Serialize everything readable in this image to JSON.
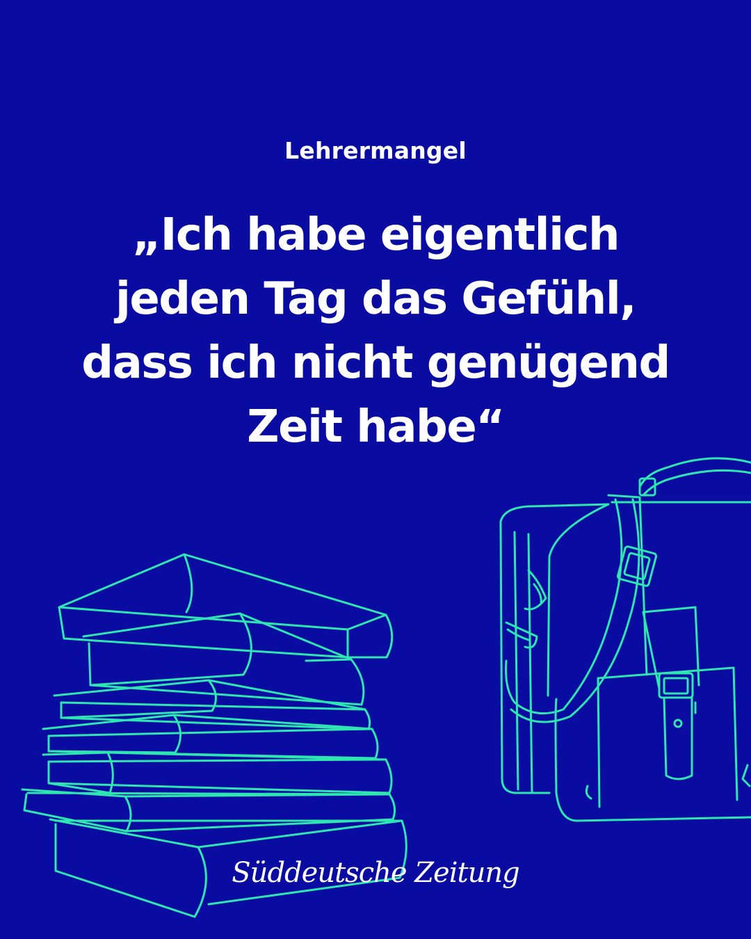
{
  "post": {
    "kicker": "Lehrermangel",
    "headline_lines": [
      "„Ich habe eigentlich",
      "jeden Tag das Gefühl,",
      "dass ich nicht genügend",
      "Zeit habe“"
    ]
  },
  "brand": {
    "logo_text": "Süddeutsche Zeitung"
  },
  "illustration": {
    "items": [
      "book-stack-illustration",
      "school-bag-illustration"
    ],
    "line_color": "#2ee6b0",
    "background_color": "#0a0ba0"
  }
}
